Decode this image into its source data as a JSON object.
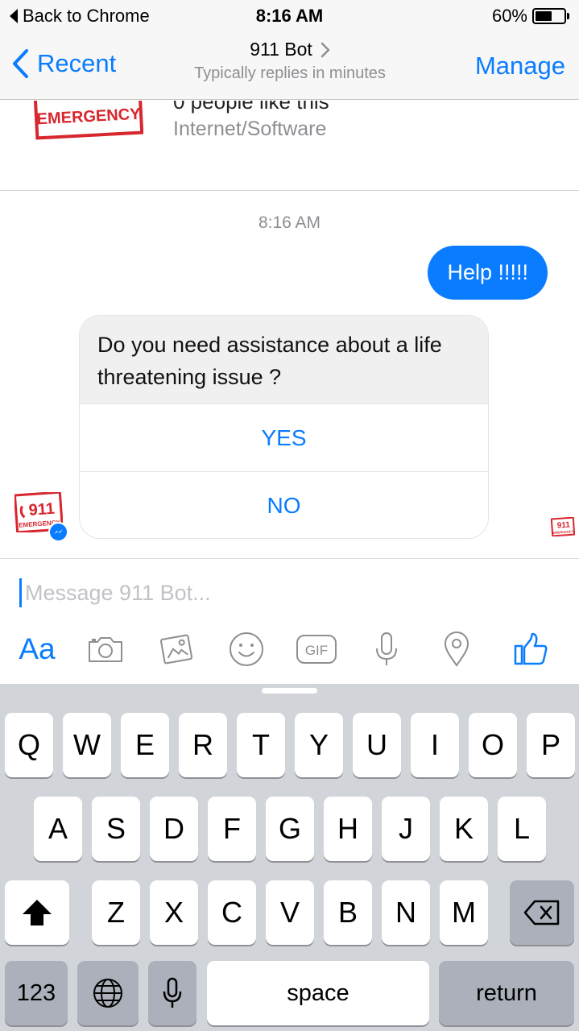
{
  "status_bar": {
    "back_label": "Back to Chrome",
    "time": "8:16 AM",
    "battery_percent_label": "60%",
    "battery_level": 0.6
  },
  "nav": {
    "back_label": "Recent",
    "title": "911 Bot",
    "subtitle": "Typically replies in minutes",
    "manage_label": "Manage"
  },
  "page_info": {
    "logo_text": "EMERGENCY",
    "likes_text": "0 people like this",
    "category": "Internet/Software"
  },
  "chat": {
    "timestamp": "8:16 AM",
    "outgoing_message": "Help !!!!!",
    "bot_card": {
      "text": "Do you need assistance about a life threatening issue ?",
      "buttons": [
        "YES",
        "NO"
      ]
    },
    "avatar_text": "911",
    "avatar_sub_text": "EMERGENCY"
  },
  "composer": {
    "placeholder": "Message 911 Bot...",
    "value": "",
    "aa_label": "Aa",
    "gif_label": "GIF"
  },
  "keyboard": {
    "row1": [
      "Q",
      "W",
      "E",
      "R",
      "T",
      "Y",
      "U",
      "I",
      "O",
      "P"
    ],
    "row2": [
      "A",
      "S",
      "D",
      "F",
      "G",
      "H",
      "J",
      "K",
      "L"
    ],
    "row3": [
      "Z",
      "X",
      "C",
      "V",
      "B",
      "N",
      "M"
    ],
    "numbers_label": "123",
    "space_label": "space",
    "return_label": "return"
  },
  "colors": {
    "accent": "#0a7cff",
    "emergency_red": "#d8262e",
    "keyboard_bg": "#d1d4d9"
  }
}
